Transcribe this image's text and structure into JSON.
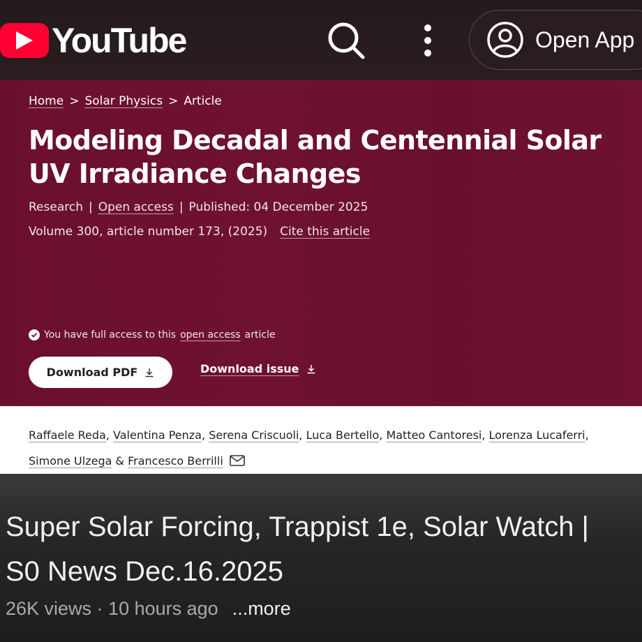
{
  "app": {
    "brand": "YouTube",
    "open_app_label": "Open App",
    "colors": {
      "brand_red": "#ff0033",
      "article_bg": "#6b0f30"
    },
    "icons": [
      "youtube-play-icon",
      "search-icon",
      "kebab-menu-icon",
      "account-icon"
    ]
  },
  "article": {
    "breadcrumb": {
      "home": "Home",
      "sep1": ">",
      "category": "Solar Physics",
      "sep2": ">",
      "current": "Article"
    },
    "title": "Modeling Decadal and Centennial Solar UV Irradiance Changes",
    "meta": {
      "type": "Research",
      "sep1": "|",
      "access": "Open access",
      "sep2": "|",
      "published": "Published: 04 December 2025",
      "volume": "Volume 300, article number 173, (2025)",
      "cite": "Cite this article"
    },
    "access_note": {
      "pre": "You have full access to this",
      "link": "open access",
      "post": "article"
    },
    "download_pdf": "Download PDF",
    "download_issue": "Download issue"
  },
  "authors": {
    "line1": [
      "Raffaele Reda",
      "Valentina Penza",
      "Serena Criscuoli",
      "Luca Bertello",
      "Matteo Cantoresi",
      "Lorenza Lucaferri"
    ],
    "line2": [
      "Simone Ulzega",
      "Francesco Berrilli"
    ],
    "comma": ",",
    "amp": "&"
  },
  "video": {
    "title_line1": "Super Solar Forcing, Trappist 1e, Solar Watch |",
    "title_line2": "S0 News Dec.16.2025",
    "views": "26K views · 10 hours ago",
    "more": "...more"
  }
}
